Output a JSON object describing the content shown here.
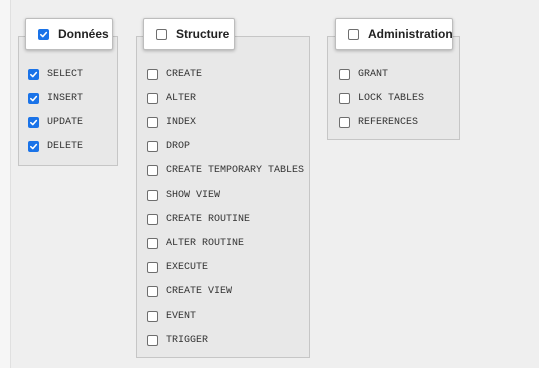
{
  "groups": {
    "donnees": {
      "title": "Données",
      "checked": true,
      "items": [
        {
          "label": "SELECT",
          "checked": true
        },
        {
          "label": "INSERT",
          "checked": true
        },
        {
          "label": "UPDATE",
          "checked": true
        },
        {
          "label": "DELETE",
          "checked": true
        }
      ]
    },
    "structure": {
      "title": "Structure",
      "checked": false,
      "items": [
        {
          "label": "CREATE",
          "checked": false
        },
        {
          "label": "ALTER",
          "checked": false
        },
        {
          "label": "INDEX",
          "checked": false
        },
        {
          "label": "DROP",
          "checked": false
        },
        {
          "label": "CREATE TEMPORARY TABLES",
          "checked": false
        },
        {
          "label": "SHOW VIEW",
          "checked": false
        },
        {
          "label": "CREATE ROUTINE",
          "checked": false
        },
        {
          "label": "ALTER ROUTINE",
          "checked": false
        },
        {
          "label": "EXECUTE",
          "checked": false
        },
        {
          "label": "CREATE VIEW",
          "checked": false
        },
        {
          "label": "EVENT",
          "checked": false
        },
        {
          "label": "TRIGGER",
          "checked": false
        }
      ]
    },
    "administration": {
      "title": "Administration",
      "checked": false,
      "items": [
        {
          "label": "GRANT",
          "checked": false
        },
        {
          "label": "LOCK TABLES",
          "checked": false
        },
        {
          "label": "REFERENCES",
          "checked": false
        }
      ]
    }
  },
  "colors": {
    "checked_fill": "#1a73e8",
    "panel_bg": "#e8e8e8",
    "page_bg": "#efefef"
  }
}
